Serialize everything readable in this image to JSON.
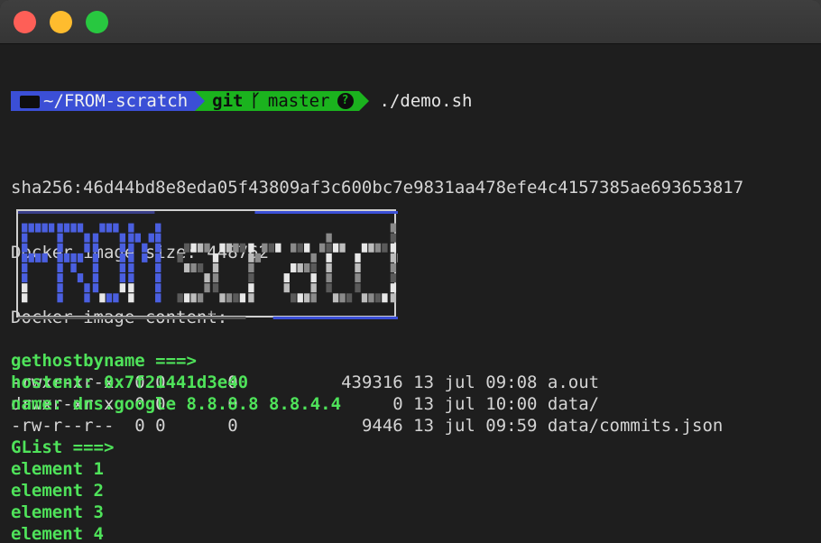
{
  "prompt": {
    "directory": "~/FROM-scratch",
    "git_label": "git",
    "branch": "master",
    "status_symbol": "?",
    "command": "./demo.sh"
  },
  "output": {
    "sha": "sha256:46d44bd8e8eda05f43809af3c600bc7e9831aa478efe4c4157385ae693653817",
    "size_line": "Docker image size: 448762",
    "content_line": "Docker image content:",
    "files": [
      {
        "perm": "-rwxr-xr-x",
        "uid": "0",
        "gid": "0",
        "x": "0",
        "size": "439316",
        "day": "13",
        "month": "jul",
        "time": "09:08",
        "name": "a.out"
      },
      {
        "perm": "drwxr-xr-x",
        "uid": "0",
        "gid": "0",
        "x": "0",
        "size": "0",
        "day": "13",
        "month": "jul",
        "time": "10:00",
        "name": "data/"
      },
      {
        "perm": "-rw-r--r--",
        "uid": "0",
        "gid": "0",
        "x": "0",
        "size": "9446",
        "day": "13",
        "month": "jul",
        "time": "09:59",
        "name": "data/commits.json"
      }
    ],
    "banner_text": "FROM scratch",
    "section1": [
      "gethostbyname ===>",
      "hostent: 0x7f21441d3e40",
      "name: dns.google 8.8.8.8 8.8.4.4"
    ],
    "section2": [
      "GList ===>",
      "element 1",
      "element 2",
      "element 3",
      "element 4"
    ]
  },
  "colors": {
    "dir_segment": "#3b4fd6",
    "git_segment": "#1bb31e",
    "program_output": "#4fe35a",
    "banner_blue": "#4a5fe0"
  }
}
